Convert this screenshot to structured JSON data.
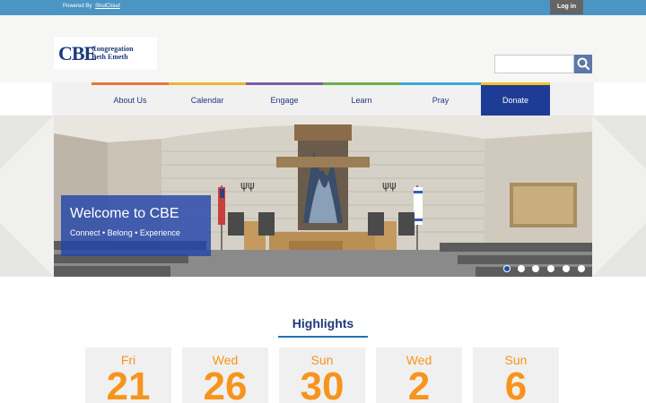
{
  "topbar": {
    "powered_by": "Powered By",
    "powered_link": "ShulCloud",
    "login_label": "Log in"
  },
  "header": {
    "logo_mark": "CBE",
    "logo_line1": "Congregation",
    "logo_line2": "Beth Emeth",
    "search": {
      "placeholder": "",
      "value": "",
      "icon": "search-icon"
    }
  },
  "nav": {
    "items": [
      {
        "label": "About Us",
        "accent": "#e8773a"
      },
      {
        "label": "Calendar",
        "accent": "#f2b134"
      },
      {
        "label": "Engage",
        "accent": "#7a5ea8"
      },
      {
        "label": "Learn",
        "accent": "#6cae4f"
      },
      {
        "label": "Pray",
        "accent": "#3aa7d9"
      },
      {
        "label": "Donate",
        "accent": "#f2c12e"
      }
    ]
  },
  "hero": {
    "title": "Welcome to CBE",
    "subtitle": "Connect • Belong • Experience",
    "slide_count": 6,
    "active_slide": 1
  },
  "highlights": {
    "title": "Highlights",
    "cards": [
      {
        "day": "Fri",
        "date": "21"
      },
      {
        "day": "Wed",
        "date": "26"
      },
      {
        "day": "Sun",
        "date": "30"
      },
      {
        "day": "Wed",
        "date": "2"
      },
      {
        "day": "Sun",
        "date": "6"
      }
    ]
  },
  "colors": {
    "topbar": "#4a95c3",
    "brand_blue": "#1d3a7a",
    "donate": "#1e3c96",
    "accent_orange": "#f7941d"
  }
}
